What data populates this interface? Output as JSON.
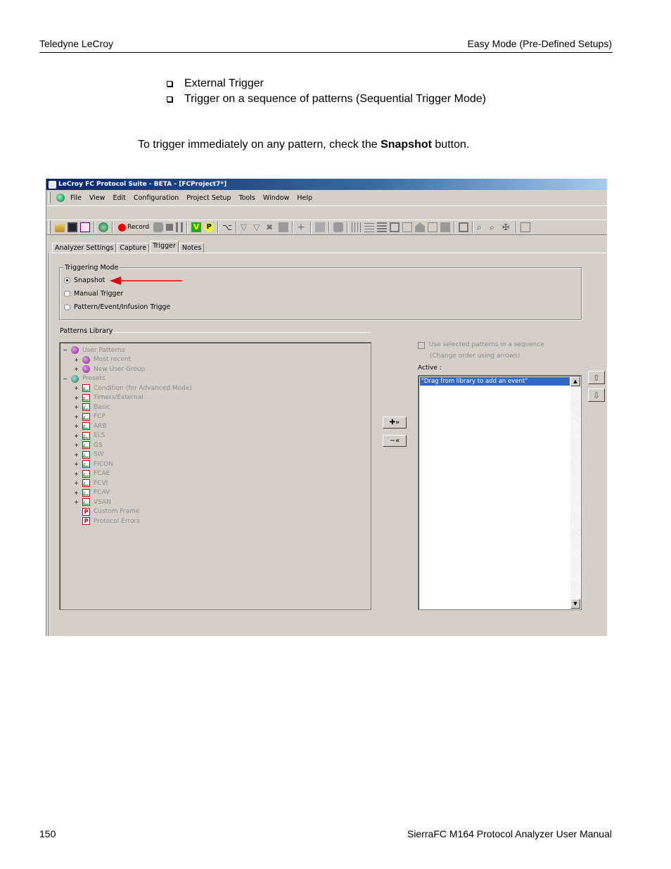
{
  "header": {
    "left": "Teledyne LeCroy",
    "right": "Easy Mode (Pre-Defined Setups)"
  },
  "bullets": [
    "External Trigger",
    "Trigger on a sequence of patterns (Sequential Trigger Mode)"
  ],
  "paragraph": {
    "before": "To trigger immediately on any pattern, check the ",
    "bold": "Snapshot",
    "after": " button."
  },
  "app": {
    "title": "LeCroy FC Protocol Suite - BETA - [FCProject7*]",
    "menu": [
      "File",
      "View",
      "Edit",
      "Configuration",
      "Project Setup",
      "Tools",
      "Window",
      "Help"
    ],
    "toolbar": {
      "record_label": "Record",
      "icons": [
        "open-icon",
        "save-icon",
        "settings-icon",
        "analyzer-icon",
        "record-icon",
        "stop-icon",
        "pause-icon",
        "v-icon",
        "p-icon",
        "find-icon",
        "filter-icon",
        "zoom-in-icon",
        "zoom-out-icon"
      ]
    },
    "tabs": [
      "Analyzer Settings",
      "Capture",
      "Trigger",
      "Notes"
    ],
    "active_tab": "Trigger",
    "triggering_mode": {
      "label": "Triggering Mode",
      "options": [
        "Snapshot",
        "Manual Trigger",
        "Pattern/Event/Infusion Trigge"
      ],
      "selected": "Snapshot"
    },
    "patterns_library": {
      "label": "Patterns Library",
      "tree": [
        {
          "label": "User Patterns",
          "level": 0,
          "expander": "−",
          "icon": "purple"
        },
        {
          "label": "Most recent",
          "level": 1,
          "expander": "+",
          "icon": "purple"
        },
        {
          "label": "New User Group",
          "level": 1,
          "expander": "+",
          "icon": "purple"
        },
        {
          "label": "Presets",
          "level": 0,
          "expander": "−",
          "icon": "teal"
        },
        {
          "label": "Condition (for Advanced Mode)",
          "level": 1,
          "expander": "+",
          "icon": "pattern"
        },
        {
          "label": "Timers/External",
          "level": 1,
          "expander": "+",
          "icon": "pattern"
        },
        {
          "label": "Basic",
          "level": 1,
          "expander": "+",
          "icon": "pattern"
        },
        {
          "label": "FCP",
          "level": 1,
          "expander": "+",
          "icon": "pattern"
        },
        {
          "label": "ARB",
          "level": 1,
          "expander": "+",
          "icon": "pattern"
        },
        {
          "label": "ELS",
          "level": 1,
          "expander": "+",
          "icon": "pattern"
        },
        {
          "label": "GS",
          "level": 1,
          "expander": "+",
          "icon": "pattern"
        },
        {
          "label": "SW",
          "level": 1,
          "expander": "+",
          "icon": "pattern"
        },
        {
          "label": "FICON",
          "level": 1,
          "expander": "+",
          "icon": "pattern"
        },
        {
          "label": "FCAE",
          "level": 1,
          "expander": "+",
          "icon": "pattern"
        },
        {
          "label": "FCVI",
          "level": 1,
          "expander": "+",
          "icon": "pattern"
        },
        {
          "label": "FCAV",
          "level": 1,
          "expander": "+",
          "icon": "pattern"
        },
        {
          "label": "VSAN",
          "level": 1,
          "expander": "+",
          "icon": "pattern"
        },
        {
          "label": "Custom Frame",
          "level": 1,
          "expander": "",
          "icon": "pbox"
        },
        {
          "label": "Protocol Errors",
          "level": 1,
          "expander": "",
          "icon": "pbox"
        }
      ]
    },
    "sequence": {
      "checkbox_label": "Use selected patterns in a sequence",
      "hint": "(Change order using arrows)",
      "active_label": "Active :",
      "active_items": [
        "\"Drag from library to add an event\""
      ]
    }
  },
  "footer": {
    "page_number": "150",
    "title": "SierraFC M164 Protocol Analyzer User Manual"
  }
}
